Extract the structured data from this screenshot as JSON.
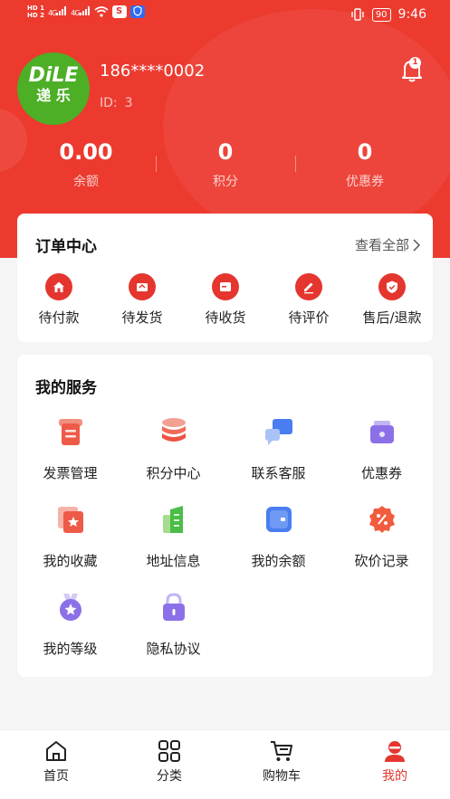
{
  "status_bar": {
    "left_hd1": "HD 1",
    "left_hd2": "HD 2",
    "signal1": "4G",
    "signal2": "4G",
    "app_s": "S",
    "battery": "90",
    "time": "9:46"
  },
  "profile": {
    "avatar_line1": "DiLE",
    "avatar_line2": "递 乐",
    "phone": "186****0002",
    "id_label": "ID:",
    "id_value": "3",
    "notification_count": "1"
  },
  "stats": [
    {
      "value": "0.00",
      "label": "余额"
    },
    {
      "value": "0",
      "label": "积分"
    },
    {
      "value": "0",
      "label": "优惠券"
    }
  ],
  "orders": {
    "title": "订单中心",
    "view_all": "查看全部",
    "items": [
      {
        "label": "待付款",
        "icon": "house-icon"
      },
      {
        "label": "待发货",
        "icon": "box-send-icon"
      },
      {
        "label": "待收货",
        "icon": "box-receive-icon"
      },
      {
        "label": "待评价",
        "icon": "pencil-icon"
      },
      {
        "label": "售后/退款",
        "icon": "shield-check-icon"
      }
    ]
  },
  "services": {
    "title": "我的服务",
    "items": [
      {
        "label": "发票管理",
        "icon": "invoice-icon"
      },
      {
        "label": "积分中心",
        "icon": "coins-stack-icon"
      },
      {
        "label": "联系客服",
        "icon": "chat-icon"
      },
      {
        "label": "优惠券",
        "icon": "wallet-icon"
      },
      {
        "label": "我的收藏",
        "icon": "star-card-icon"
      },
      {
        "label": "地址信息",
        "icon": "building-icon"
      },
      {
        "label": "我的余额",
        "icon": "balance-card-icon"
      },
      {
        "label": "砍价记录",
        "icon": "discount-badge-icon"
      },
      {
        "label": "我的等级",
        "icon": "medal-icon"
      },
      {
        "label": "隐私协议",
        "icon": "lock-icon"
      }
    ]
  },
  "tabbar": [
    {
      "label": "首页",
      "icon": "home-icon"
    },
    {
      "label": "分类",
      "icon": "grid-icon"
    },
    {
      "label": "购物车",
      "icon": "cart-icon"
    },
    {
      "label": "我的",
      "icon": "user-icon",
      "active": true
    }
  ],
  "colors": {
    "brand_red": "#ec3a2f",
    "accent_red": "#e4362f",
    "avatar_green": "#4caf26"
  }
}
